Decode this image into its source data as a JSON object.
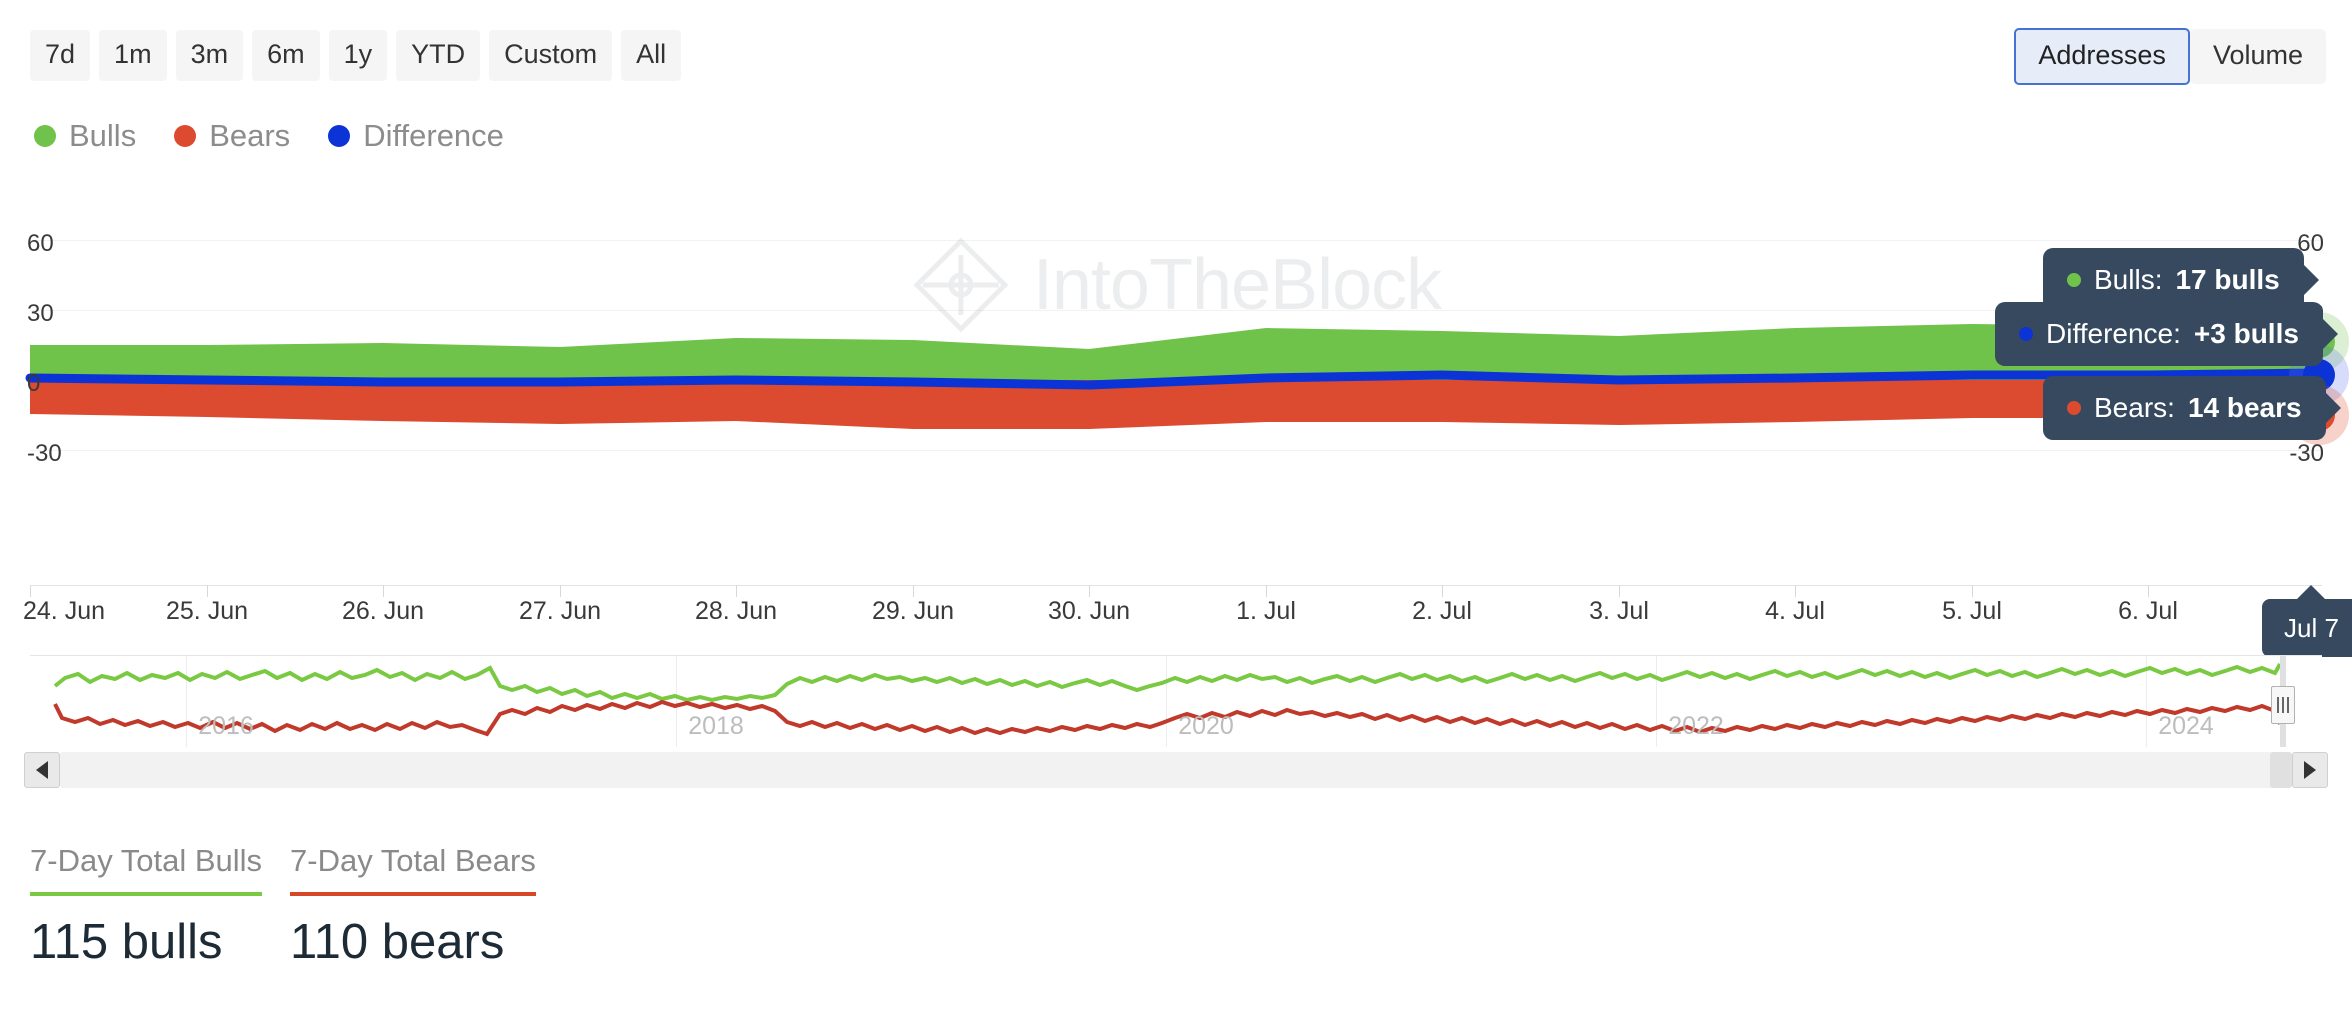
{
  "range_buttons": [
    {
      "label": "7d",
      "selected": false
    },
    {
      "label": "1m",
      "selected": false
    },
    {
      "label": "3m",
      "selected": false
    },
    {
      "label": "6m",
      "selected": false
    },
    {
      "label": "1y",
      "selected": false
    },
    {
      "label": "YTD",
      "selected": false
    },
    {
      "label": "Custom",
      "selected": false
    },
    {
      "label": "All",
      "selected": false
    }
  ],
  "metric_toggle": {
    "addresses_label": "Addresses",
    "volume_label": "Volume",
    "selected": "Addresses",
    "selected_border_color": "#4572d3",
    "selected_fill_color": "#e6edf8"
  },
  "legend": [
    {
      "label": "Bulls",
      "color": "#6FC24A",
      "icon": "legend-dot-bulls"
    },
    {
      "label": "Bears",
      "color": "#DC4B2F",
      "icon": "legend-dot-bears"
    },
    {
      "label": "Difference",
      "color": "#0B33D6",
      "icon": "legend-dot-difference"
    }
  ],
  "watermark": {
    "text": "IntoTheBlock",
    "color": "#30404f"
  },
  "tooltips": {
    "bulls": {
      "prefix": "Bulls:",
      "value": "17 bulls",
      "dot_color": "#6FC24A"
    },
    "difference": {
      "prefix": "Difference:",
      "value": "+3 bulls",
      "dot_color": "#0B33D6"
    },
    "bears": {
      "prefix": "Bears:",
      "value": "14 bears",
      "dot_color": "#DC4B2F"
    },
    "date": {
      "label": "Jul 7"
    }
  },
  "summary": [
    {
      "title": "7-Day Total Bulls",
      "value": "115 bulls",
      "color": "#7AC943"
    },
    {
      "title": "7-Day Total Bears",
      "value": "110 bears",
      "color": "#D64728"
    }
  ],
  "navigator": {
    "years": [
      "2016",
      "2018",
      "2020",
      "2022",
      "2024"
    ],
    "bulls_color": "#7AC943",
    "bears_color": "#C0392B",
    "handle_icon": "navigator-right-handle"
  },
  "scrollbar": {
    "left_arrow_icon": "scroll-left-arrow-icon",
    "right_arrow_icon": "scroll-right-arrow-icon"
  },
  "chart_data": {
    "type": "area",
    "title": "",
    "xlabel": "",
    "ylabel": "",
    "ylim": [
      -30,
      60
    ],
    "yticks": [
      -30,
      0,
      30,
      60
    ],
    "ytick_labels_left": [
      "-30",
      "0",
      "30",
      "60"
    ],
    "ytick_labels_right": [
      "-30",
      "0",
      "30",
      "60"
    ],
    "grid": true,
    "legend_position": "top-left",
    "x_tick_labels": [
      "24. Jun",
      "25. Jun",
      "26. Jun",
      "27. Jun",
      "28. Jun",
      "29. Jun",
      "30. Jun",
      "1. Jul",
      "2. Jul",
      "3. Jul",
      "4. Jul",
      "5. Jul",
      "6. Jul"
    ],
    "x": [
      "24. Jun",
      "25. Jun",
      "26. Jun",
      "27. Jun",
      "28. Jun",
      "29. Jun",
      "30. Jun",
      "1. Jul",
      "2. Jul",
      "3. Jul",
      "4. Jul",
      "5. Jul",
      "6. Jul",
      "Jul 7"
    ],
    "series": [
      {
        "name": "Bulls",
        "color": "#6FC24A",
        "unit": "bulls",
        "values": [
          15,
          15,
          15,
          14,
          16,
          16,
          14,
          18,
          18,
          17,
          18,
          19,
          18,
          17
        ]
      },
      {
        "name": "Bears",
        "color": "#DC4B2F",
        "unit": "bears",
        "values": [
          -14,
          -15,
          -16,
          -17,
          -16,
          -18,
          -18,
          -16,
          -16,
          -17,
          -16,
          -15,
          -15,
          -14
        ]
      },
      {
        "name": "Difference",
        "color": "#0B33D6",
        "unit": "bulls",
        "values": [
          1,
          0,
          -1,
          -1,
          0,
          -1,
          -2,
          1,
          2,
          0,
          1,
          2,
          2,
          3
        ]
      }
    ],
    "navigator_series": [
      {
        "name": "Bulls",
        "color": "#7AC943"
      },
      {
        "name": "Bears",
        "color": "#C0392B"
      }
    ]
  }
}
